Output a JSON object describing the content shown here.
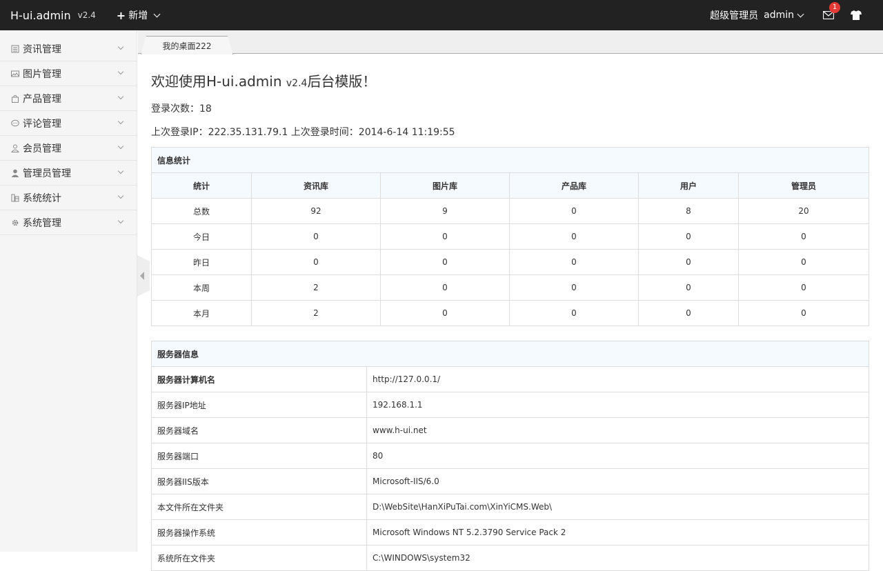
{
  "header": {
    "logo": "H-ui.admin",
    "version": "v2.4",
    "add_new": "新增",
    "role": "超级管理员",
    "username": "admin",
    "message_count": "1"
  },
  "sidebar": {
    "items": [
      {
        "label": "资讯管理",
        "icon": "news-icon"
      },
      {
        "label": "图片管理",
        "icon": "picture-icon"
      },
      {
        "label": "产品管理",
        "icon": "bag-icon"
      },
      {
        "label": "评论管理",
        "icon": "comment-icon"
      },
      {
        "label": "会员管理",
        "icon": "user-icon"
      },
      {
        "label": "管理员管理",
        "icon": "admin-icon"
      },
      {
        "label": "系统统计",
        "icon": "stats-icon"
      },
      {
        "label": "系统管理",
        "icon": "gear-icon"
      }
    ]
  },
  "tabs": [
    {
      "label": "我的桌面222"
    }
  ],
  "main": {
    "welcome_prefix": "欢迎使用H-ui.admin ",
    "welcome_version": "v2.4",
    "welcome_suffix": "后台模版！",
    "login_count": "登录次数：18",
    "last_login": "上次登录IP：222.35.131.79.1 上次登录时间：2014-6-14 11:19:55"
  },
  "stats_table": {
    "caption": "信息统计",
    "headers": [
      "统计",
      "资讯库",
      "图片库",
      "产品库",
      "用户",
      "管理员"
    ],
    "rows": [
      [
        "总数",
        "92",
        "9",
        "0",
        "8",
        "20"
      ],
      [
        "今日",
        "0",
        "0",
        "0",
        "0",
        "0"
      ],
      [
        "昨日",
        "0",
        "0",
        "0",
        "0",
        "0"
      ],
      [
        "本周",
        "2",
        "0",
        "0",
        "0",
        "0"
      ],
      [
        "本月",
        "2",
        "0",
        "0",
        "0",
        "0"
      ]
    ]
  },
  "server_table": {
    "caption": "服务器信息",
    "rows": [
      [
        "服务器计算机名",
        "http://127.0.0.1/"
      ],
      [
        "服务器IP地址",
        "192.168.1.1"
      ],
      [
        "服务器域名",
        "www.h-ui.net"
      ],
      [
        "服务器端口",
        "80"
      ],
      [
        "服务器IIS版本",
        "Microsoft-IIS/6.0"
      ],
      [
        "本文件所在文件夹",
        "D:\\WebSite\\HanXiPuTai.com\\XinYiCMS.Web\\"
      ],
      [
        "服务器操作系统",
        "Microsoft Windows NT 5.2.3790 Service Pack 2"
      ],
      [
        "系统所在文件夹",
        "C:\\WINDOWS\\system32"
      ]
    ]
  }
}
